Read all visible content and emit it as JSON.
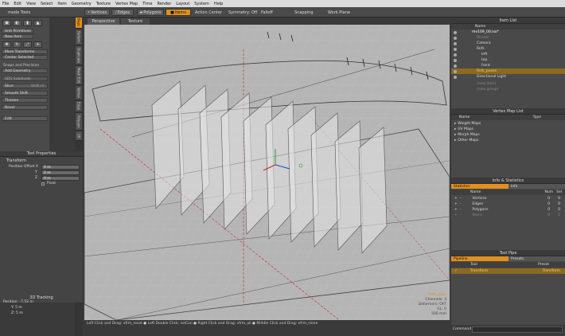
{
  "menu": [
    "File",
    "Edit",
    "View",
    "Select",
    "Item",
    "Geometry",
    "Texture",
    "Vertex Map",
    "Time",
    "Render",
    "Layout",
    "System",
    "Help"
  ],
  "toolbar": {
    "modo_tools": "modo Tools",
    "modes": [
      "Vertices",
      "Edges",
      "Polygons",
      "Items"
    ],
    "action_center": "Action Center",
    "symmetry": "Symmetry: Off",
    "falloff": "Falloff",
    "snapping": "Snapping",
    "work_plane": "Work Plane"
  },
  "left": {
    "unit_primitives": "Unit Primitives",
    "new_item": "New Item",
    "more_transforms": "More Transforms",
    "center_selected": "Center Selected",
    "snaps_precision": "Snaps and Precision",
    "add_geometry": "Add Geometry",
    "sds_subdivide": "SDS Subdivide",
    "slice": "Slice",
    "slice_key": "Shift+C",
    "smooth_shift": "Smooth Shift",
    "thicken": "Thicken",
    "bevel": "Bevel",
    "edit": "Edit"
  },
  "side_tabs": [
    "Basic",
    "Deform",
    "Duplicate",
    "Mesh Edit",
    "Vertex",
    "Edge",
    "Polygon",
    "UV"
  ],
  "props": {
    "title": "Tool Properties",
    "transform": "Transform",
    "position_offset": "Position Offset X",
    "y_label": "Y",
    "z_label": "Z",
    "x_val": "0 m",
    "y_val": "0 m",
    "z_val": "0 m",
    "pivot": "Pivot"
  },
  "tracking": {
    "title": "3D Tracking",
    "x": "Position: -7.52 m",
    "y": "Y: 5 m",
    "z": "Z: 5 m"
  },
  "viewport": {
    "tabs": [
      "Perspective",
      "Texture"
    ],
    "info": [
      "Refs_pose",
      "Channels: 3",
      "Deformers: OFF",
      "GL: 0",
      "500 mm"
    ]
  },
  "status": "Left Click and Drag: xfrm_reset  ● Left Double Click: selCon  ● Right Click and Drag: xfrm_all  ● Middle Click and Drag: xfrm_slone",
  "item_list": {
    "title": "Item List",
    "col_name": "Name",
    "rows": [
      "me109_00.lxo*",
      "Render",
      "Camera",
      "Refs",
      "left",
      "top",
      "front",
      "Refs_poses",
      "Directional Light",
      "(new item)",
      "(new group)"
    ]
  },
  "vertex_map": {
    "title": "Vertex Map List",
    "col_name": "Name",
    "col_type": "Type",
    "rows": [
      "Weight Maps",
      "UV Maps",
      "Morph Maps",
      "Other Maps"
    ]
  },
  "info_stats": {
    "title": "Info & Statistics",
    "tabs": [
      "Statistics",
      "Info"
    ],
    "col_name": "Name",
    "col_num": "Num",
    "col_sel": "Sel",
    "rows": [
      "Vertices",
      "Edges",
      "Polygons",
      "Items"
    ],
    "nums": [
      "0",
      "0",
      "0",
      "0"
    ],
    "sels": [
      "0",
      "0",
      "0",
      "0"
    ]
  },
  "tool_pipe": {
    "title": "Tool Pipe",
    "tabs": [
      "Pipeline",
      "Presets"
    ],
    "col_tool": "Tool",
    "col_preset": "Preset",
    "row_tool": "Transform",
    "row_preset": "Transform"
  },
  "command_label": "Command"
}
